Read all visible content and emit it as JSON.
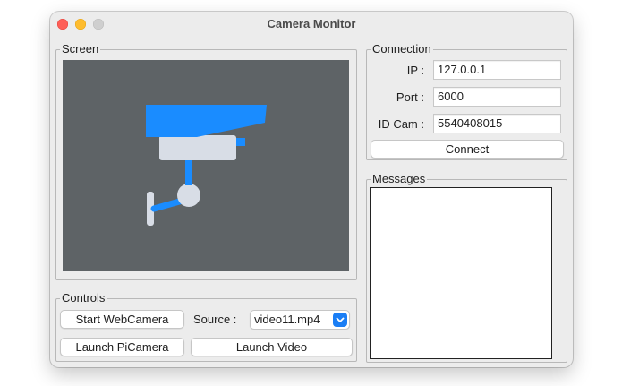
{
  "window": {
    "title": "Camera Monitor"
  },
  "screen": {
    "legend": "Screen"
  },
  "controls": {
    "legend": "Controls",
    "start_webcam": "Start WebCamera",
    "source_label": "Source :",
    "source_value": "video11.mp4",
    "launch_picamera": "Launch PiCamera",
    "launch_video": "Launch Video"
  },
  "connection": {
    "legend": "Connection",
    "ip_label": "IP :",
    "ip_value": "127.0.0.1",
    "port_label": "Port :",
    "port_value": "6000",
    "idcam_label": "ID Cam :",
    "idcam_value": "5540408015",
    "connect_label": "Connect"
  },
  "messages": {
    "legend": "Messages",
    "content": ""
  },
  "icons": {
    "screen_placeholder": "security-camera-icon",
    "select_chevron": "chevron-down-icon"
  },
  "colors": {
    "screen_bg": "#5e6366",
    "camera_blue": "#1a8cff",
    "camera_body": "#d8dde6",
    "accent": "#1a7ef5"
  }
}
